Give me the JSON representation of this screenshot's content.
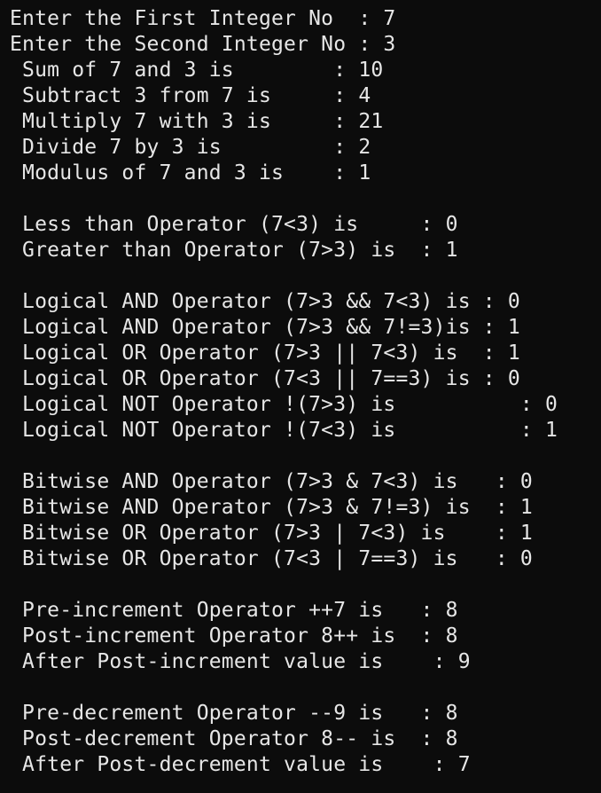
{
  "terminal": {
    "lines": [
      "Enter the First Integer No  : 7",
      "Enter the Second Integer No : 3",
      " Sum of 7 and 3 is        : 10",
      " Subtract 3 from 7 is     : 4",
      " Multiply 7 with 3 is     : 21",
      " Divide 7 by 3 is         : 2",
      " Modulus of 7 and 3 is    : 1",
      "",
      " Less than Operator (7<3) is     : 0",
      " Greater than Operator (7>3) is  : 1",
      "",
      " Logical AND Operator (7>3 && 7<3) is : 0",
      " Logical AND Operator (7>3 && 7!=3)is : 1",
      " Logical OR Operator (7>3 || 7<3) is  : 1",
      " Logical OR Operator (7<3 || 7==3) is : 0",
      " Logical NOT Operator !(7>3) is          : 0",
      " Logical NOT Operator !(7<3) is          : 1",
      "",
      " Bitwise AND Operator (7>3 & 7<3) is   : 0",
      " Bitwise AND Operator (7>3 & 7!=3) is  : 1",
      " Bitwise OR Operator (7>3 | 7<3) is    : 1",
      " Bitwise OR Operator (7<3 | 7==3) is   : 0",
      "",
      " Pre-increment Operator ++7 is   : 8",
      " Post-increment Operator 8++ is  : 8",
      " After Post-increment value is    : 9",
      "",
      " Pre-decrement Operator --9 is   : 8",
      " Post-decrement Operator 8-- is  : 8",
      " After Post-decrement value is    : 7"
    ]
  }
}
